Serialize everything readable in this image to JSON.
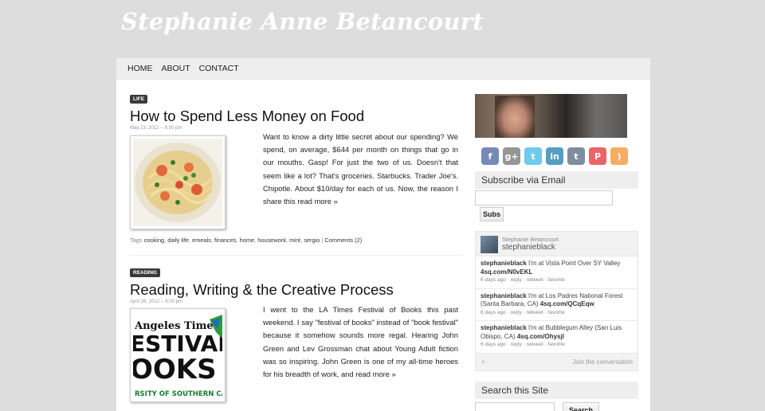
{
  "site_title": "Stephanie Anne Betancourt",
  "nav": [
    "HOME",
    "ABOUT",
    "CONTACT"
  ],
  "posts": [
    {
      "category": "LIFE",
      "title": "How to Spend Less Money on Food",
      "date": "May 23, 2012 -- 6:00 pm",
      "excerpt": "Want to know a dirty little secret about our spending? We spend, on average, $644 per month on things that go in our mouths. Gasp! For just the two of us. Doesn't that seem like a lot? That's groceries. Starbucks. Trader Joe's. Chipotle. About $10/day for each of us. Now, the reason I share this ",
      "read_more": "read more »",
      "tags_label": "Tags",
      "tags": [
        "cooking",
        "daily life",
        "emeals",
        "finances",
        "home",
        "housework",
        "mint",
        "sergio"
      ],
      "comments": "Comments (2)"
    },
    {
      "category": "READING",
      "title": "Reading, Writing & the Creative Process",
      "date": "April 26, 2012 -- 6:00 pm",
      "excerpt": "I went to the LA Times Festival of Books this past weekend. I say \"festival of books\" instead of \"book festival\" because it somehow sounds more regal. Hearing John Green and Lev Grossman chat about Young Adult fiction was so inspiring. John Green is one of my all-time heroes for his breadth of work, and ",
      "read_more": "read more »",
      "thumb_lines": [
        "Angeles Times",
        "ESTIVAL",
        "OOKS",
        "RSITY OF SOUTHERN CALIF"
      ]
    }
  ],
  "sidebar": {
    "social_icons": [
      {
        "icon": "facebook-icon",
        "glyph": "f",
        "color": "#3b5998"
      },
      {
        "icon": "google-plus-icon",
        "glyph": "g+",
        "color": "#6b6b6b"
      },
      {
        "icon": "twitter-icon",
        "glyph": "t",
        "color": "#33b5e5"
      },
      {
        "icon": "linkedin-icon",
        "glyph": "in",
        "color": "#0e76a8"
      },
      {
        "icon": "tumblr-icon",
        "glyph": "t",
        "color": "#4a5d77"
      },
      {
        "icon": "pinterest-icon",
        "glyph": "P",
        "color": "#e0242c"
      },
      {
        "icon": "rss-icon",
        "glyph": ")",
        "color": "#f58a1f"
      }
    ],
    "subscribe_title": "Subscribe via Email",
    "subscribe_button": "Subs",
    "twitter": {
      "name": "Stephanie Betancourt",
      "handle": "stephanieblack",
      "tweets": [
        {
          "user": "stephanieblack",
          "text": "I'm at Vista Point Over SY Valley",
          "link": "4sq.com/N0vEKL",
          "meta": "6 days ago · reply · retweet · favorite"
        },
        {
          "user": "stephanieblack",
          "text": "I'm at Los Padres National Forest (Santa Barbara, CA)",
          "link": "4sq.com/QCqEqw",
          "meta": "6 days ago · reply · retweet · favorite"
        },
        {
          "user": "stephanieblack",
          "text": "I'm at Bubblegum Alley (San Luis Obispo, CA)",
          "link": "4sq.com/Ohysjl",
          "meta": "6 days ago · reply · retweet · favorite"
        }
      ],
      "join": "Join the conversation"
    },
    "search_title": "Search this Site",
    "search_button": "Search"
  }
}
